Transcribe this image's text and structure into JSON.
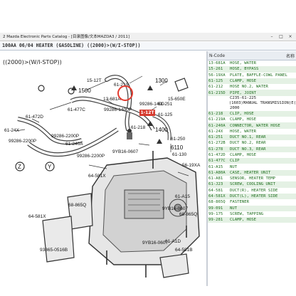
{
  "window": {
    "title": "2  Mazda Electronic Parts Catalog - [目录图像/文本MAZDA3 / 2011]",
    "buttons": [
      "–",
      "□",
      "×"
    ]
  },
  "header": {
    "title": "100AA 06/04 HEATER (GASOLINE) ((2000)>(W/I-STOP))"
  },
  "diagram": {
    "subtitle": "((2000)>(W/I-STOP))",
    "labels": {
      "l1": "15-12T",
      "l2": "1500",
      "l3": "61-219",
      "l4": "1300",
      "l5": "15-650E",
      "l6": "13-681A",
      "l7": "61-477C",
      "l8": "61-472D",
      "l9": "61-24X",
      "l10": "99286-1400",
      "l11": "99286-2200P",
      "l12": "99286-2200P",
      "l13": "61-240A",
      "l14": "99286-1400P",
      "l15": "61-251",
      "l16": "61-125",
      "l17": "61-218",
      "l18": "1400",
      "l19": "61-250",
      "l20": "6110",
      "l21": "61-130",
      "l22": "9YB16-0607",
      "l23": "56-19XA",
      "l24": "64-581X",
      "l25": "68-865Q",
      "l26": "61-A15",
      "l27": "9YB16-0607",
      "l28": "68-865Q",
      "l29": "64-581X",
      "l30": "93865-0516B",
      "l31": "61-A1D",
      "l32": "64-581B",
      "l33": "99286-2200P",
      "l34": "9YB16-0607",
      "z": "Z",
      "y": "Y",
      "hl": "1-12T"
    }
  },
  "table": {
    "headers": {
      "code": "N-Code",
      "name": "名称"
    },
    "rows": [
      {
        "code": "13-681A",
        "name": "HOSE, WATER",
        "style": ""
      },
      {
        "code": "15-261",
        "name": "HOSE, BYPASS",
        "style": "alt"
      },
      {
        "code": "56-19XA",
        "name": "PLATE, BAFFLE-COWL PANEL",
        "style": ""
      },
      {
        "code": "61-125",
        "name": "CLAMP, HOSE",
        "style": "alt"
      },
      {
        "code": "61-212",
        "name": "HOSE NO.2, WATER",
        "style": ""
      },
      {
        "code": "61-215D",
        "name": "PIPE, JOINT",
        "style": "alt"
      },
      {
        "code": "",
        "name": "C235-61-225",
        "style": "sub"
      },
      {
        "code": "",
        "name": "(1603)MANUAL TRANSMISSION)E(",
        "style": "sub"
      },
      {
        "code": "",
        "name": "2000",
        "style": "sub"
      },
      {
        "code": "61-218",
        "name": "CLIP, HOSE",
        "style": "alt"
      },
      {
        "code": "61-219A",
        "name": "CLAMP, HOSE",
        "style": ""
      },
      {
        "code": "61-240A",
        "name": "CONNECTOR, WATER HOSE",
        "style": "alt"
      },
      {
        "code": "61-24X",
        "name": "HOSE, WATER",
        "style": ""
      },
      {
        "code": "61-251",
        "name": "DUCT NO.1, REAR",
        "style": "alt"
      },
      {
        "code": "61-272B",
        "name": "DUCT NO.2, REAR",
        "style": ""
      },
      {
        "code": "61-278",
        "name": "DUCT NO.3, REAR",
        "style": "alt"
      },
      {
        "code": "61-472D",
        "name": "CLAMP, HOSE",
        "style": ""
      },
      {
        "code": "61-477C",
        "name": "CLIP",
        "style": "alt"
      },
      {
        "code": "61-A15",
        "name": "NUT",
        "style": ""
      },
      {
        "code": "61-A80A",
        "name": "CASE, HEATER UNIT",
        "style": "alt"
      },
      {
        "code": "61-A81",
        "name": "SENSOR, HEATER TEMP",
        "style": ""
      },
      {
        "code": "61-J23",
        "name": "SCREW, COOLING UNIT",
        "style": "alt"
      },
      {
        "code": "64-581",
        "name": "DUCT(R), HEATER SIDE",
        "style": ""
      },
      {
        "code": "64-581X",
        "name": "DUCT(L), HEATER SIDE",
        "style": "alt"
      },
      {
        "code": "68-865Q",
        "name": "FASTENER",
        "style": ""
      },
      {
        "code": "99-091",
        "name": "NUT",
        "style": "alt"
      },
      {
        "code": "99-175",
        "name": "SCREW, TAPPING",
        "style": ""
      },
      {
        "code": "99-281",
        "name": "CLAMP, HOSE",
        "style": "alt"
      }
    ]
  }
}
